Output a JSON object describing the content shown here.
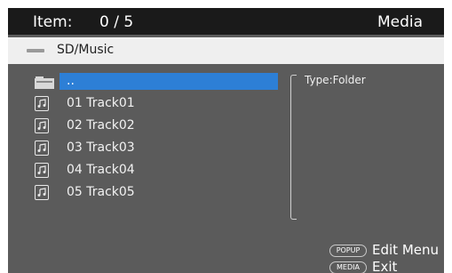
{
  "header": {
    "item_label": "Item:",
    "item_count": "0 / 5",
    "title": "Media"
  },
  "path": {
    "icon": "drive-icon",
    "text": "SD/Music"
  },
  "list": {
    "items": [
      {
        "label": "..",
        "icon": "folder-icon",
        "selected": true
      },
      {
        "label": "01 Track01",
        "icon": "music-file-icon",
        "selected": false
      },
      {
        "label": "02 Track02",
        "icon": "music-file-icon",
        "selected": false
      },
      {
        "label": "03 Track03",
        "icon": "music-file-icon",
        "selected": false
      },
      {
        "label": "04 Track04",
        "icon": "music-file-icon",
        "selected": false
      },
      {
        "label": "05 Track05",
        "icon": "music-file-icon",
        "selected": false
      }
    ]
  },
  "info": {
    "type": "Type:Folder"
  },
  "hints": {
    "popup_key": "POPUP",
    "popup_label": "Edit Menu",
    "media_key": "MEDIA",
    "media_label": "Exit"
  },
  "colors": {
    "background": "#5b5b5b",
    "header": "#1a1a1a",
    "selection": "#2d7fd6"
  }
}
